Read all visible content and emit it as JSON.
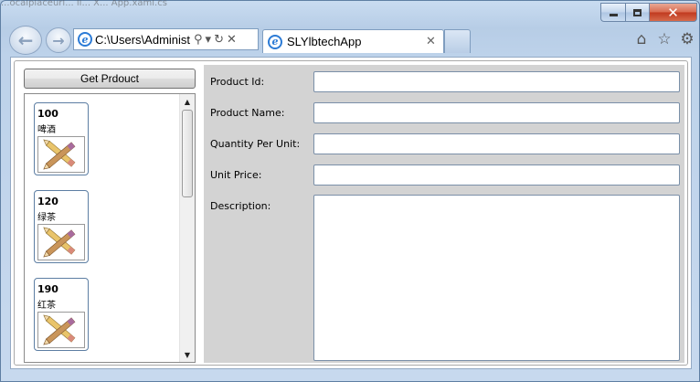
{
  "window": {
    "title": "...ocalplaceurl... ll... X... App.xaml.cs",
    "min_icon": "minimize-icon",
    "max_icon": "maximize-icon",
    "close_icon": "close-icon",
    "close_glyph": "✕"
  },
  "nav": {
    "back_glyph": "←",
    "forward_glyph": "→"
  },
  "address_bar": {
    "value": "C:\\Users\\Administ",
    "icons": [
      "search-icon",
      "dropdown-icon",
      "refresh-icon",
      "stop-icon"
    ],
    "glyphs": [
      "⚲",
      "▾",
      "↻",
      "✕"
    ]
  },
  "tab": {
    "label": "SLYlbtechApp",
    "close_glyph": "✕"
  },
  "toolbar": {
    "icons": [
      "home-icon",
      "favorites-star-icon",
      "tools-gear-icon"
    ],
    "glyphs": [
      "⌂",
      "☆",
      "⚙"
    ]
  },
  "app": {
    "get_button_label": "Get Prdouct",
    "products": [
      {
        "id": "100",
        "name": "啤酒"
      },
      {
        "id": "120",
        "name": "绿茶"
      },
      {
        "id": "190",
        "name": "红茶"
      }
    ],
    "scroll_up": "▲",
    "scroll_down": "▼",
    "form": {
      "product_id_label": "Product Id:",
      "product_name_label": "Product Name:",
      "quantity_label": "Quantity Per Unit:",
      "unit_price_label": "Unit Price:",
      "description_label": "Description:",
      "product_id_value": "",
      "product_name_value": "",
      "quantity_value": "",
      "unit_price_value": "",
      "description_value": ""
    }
  },
  "colors": {
    "chrome": "#bdd2ea",
    "form_panel": "#d3d3d3",
    "card_border": "#5d7ea3"
  }
}
